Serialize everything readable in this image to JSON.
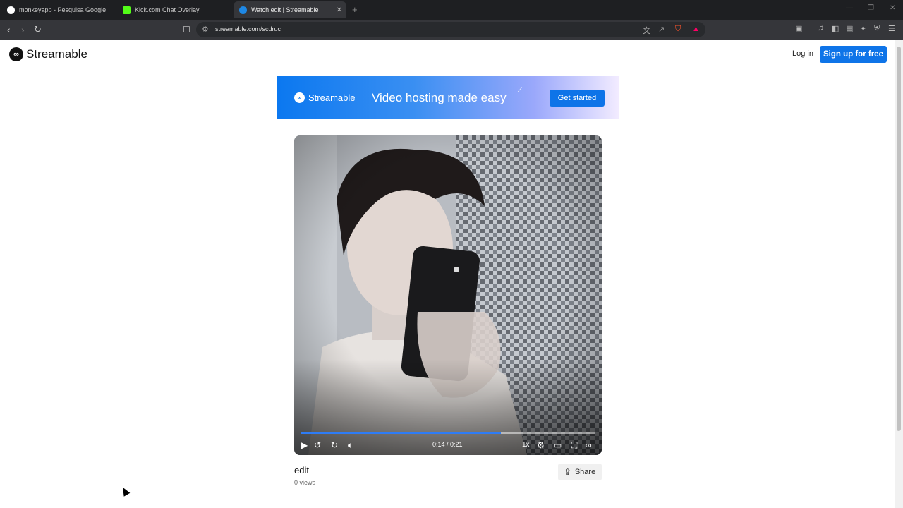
{
  "browser": {
    "tabs": [
      {
        "title": "monkeyapp - Pesquisa Google",
        "favicon_color": "#ffffff"
      },
      {
        "title": "Kick.com Chat Overlay",
        "favicon_color": "#53fc18"
      },
      {
        "title": "Watch edit | Streamable",
        "favicon_color": "#1e88e5",
        "active": true
      }
    ],
    "url": "streamable.com/scdruc"
  },
  "header": {
    "logo_text": "Streamable",
    "login_label": "Log in",
    "signup_label": "Sign up for free"
  },
  "banner": {
    "logo_text": "Streamable",
    "tagline": "Video hosting made easy",
    "cta_label": "Get started"
  },
  "player": {
    "time_display": "0:14 / 0:21",
    "progress_percent": 68,
    "speed_label": "1x"
  },
  "video": {
    "title": "edit",
    "views": "0 views",
    "share_label": "Share"
  },
  "colors": {
    "accent": "#0e74e8",
    "progress": "#2e7cf6"
  }
}
